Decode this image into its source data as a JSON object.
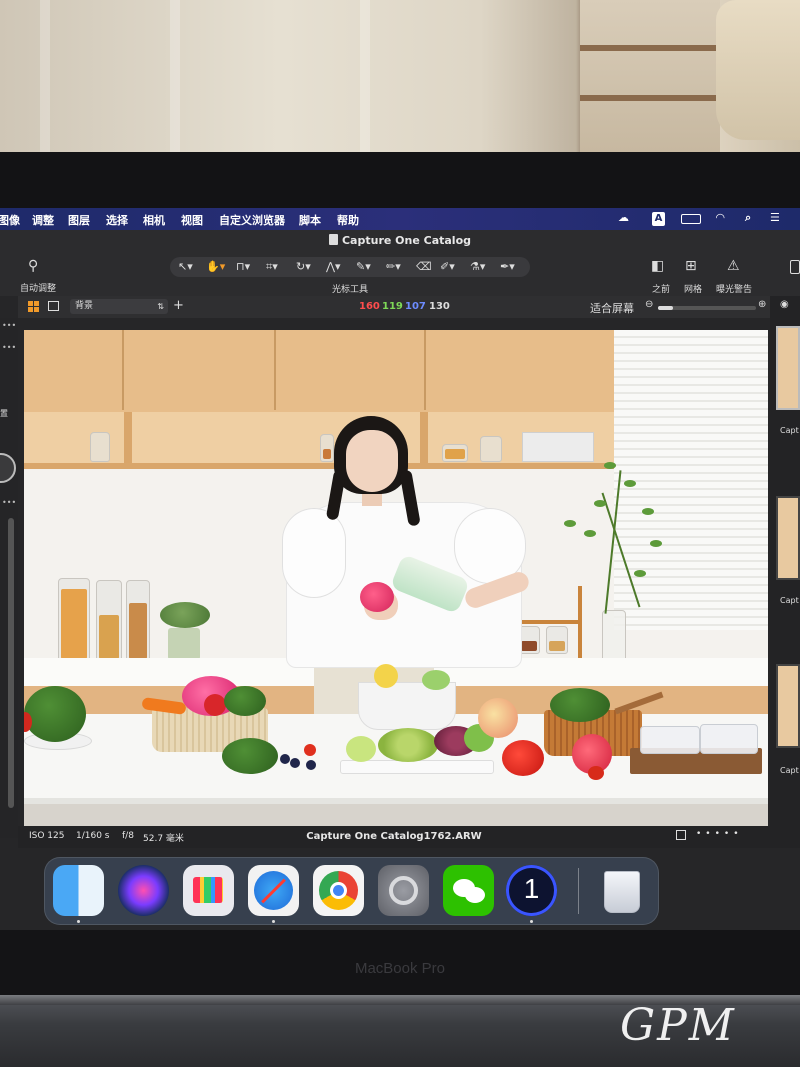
{
  "menubar": {
    "items": [
      "图像",
      "调整",
      "图层",
      "选择",
      "相机",
      "视图",
      "自定义浏览器",
      "脚本",
      "帮助"
    ],
    "status_icons": [
      "creative-cloud-icon",
      "input-method-icon",
      "battery-icon",
      "wifi-icon",
      "spotlight-search-icon",
      "control-center-icon"
    ],
    "input_method_label": "A"
  },
  "titlebar": {
    "title": "Capture One Catalog"
  },
  "toolbar": {
    "auto_adjust_label": "自动调整",
    "cursor_tools_label": "光标工具",
    "before_label": "之前",
    "grid_label": "网格",
    "exposure_warning_label": "曝光警告",
    "accent_color": "#f19a2a"
  },
  "viewer": {
    "background_select_value": "背景",
    "rgb": {
      "r": "160",
      "g": "119",
      "b": "107",
      "l": "130"
    },
    "rgb_colors": {
      "r": "#ff4d4d",
      "g": "#7ed957",
      "b": "#6d8cff"
    },
    "fit_label": "适合屏幕",
    "zoom_fraction": 0.15
  },
  "left_panel": {
    "partial_label": "置"
  },
  "status": {
    "iso": "ISO 125",
    "shutter": "1/160 s",
    "aperture": "f/8",
    "focal_length": "52.7 毫米",
    "filename": "Capture One Catalog1762.ARW"
  },
  "filmstrip": {
    "caption": "Capt"
  },
  "dock": {
    "apps": [
      {
        "name": "Finder",
        "icon": "finder-icon",
        "running": true
      },
      {
        "name": "Siri",
        "icon": "siri-icon",
        "running": false
      },
      {
        "name": "Launchpad",
        "icon": "launchpad-icon",
        "running": false
      },
      {
        "name": "Safari",
        "icon": "safari-icon",
        "running": true
      },
      {
        "name": "Chrome",
        "icon": "chrome-icon",
        "running": false
      },
      {
        "name": "System Settings",
        "icon": "settings-icon",
        "running": false
      },
      {
        "name": "WeChat",
        "icon": "wechat-icon",
        "running": false
      },
      {
        "name": "Capture One",
        "icon": "capture-one-icon",
        "running": true,
        "badge": "1"
      },
      {
        "name": "Trash",
        "icon": "trash-icon",
        "running": false
      }
    ]
  },
  "device": {
    "brand": "MacBook Pro"
  },
  "watermark": {
    "text": "GPM"
  }
}
